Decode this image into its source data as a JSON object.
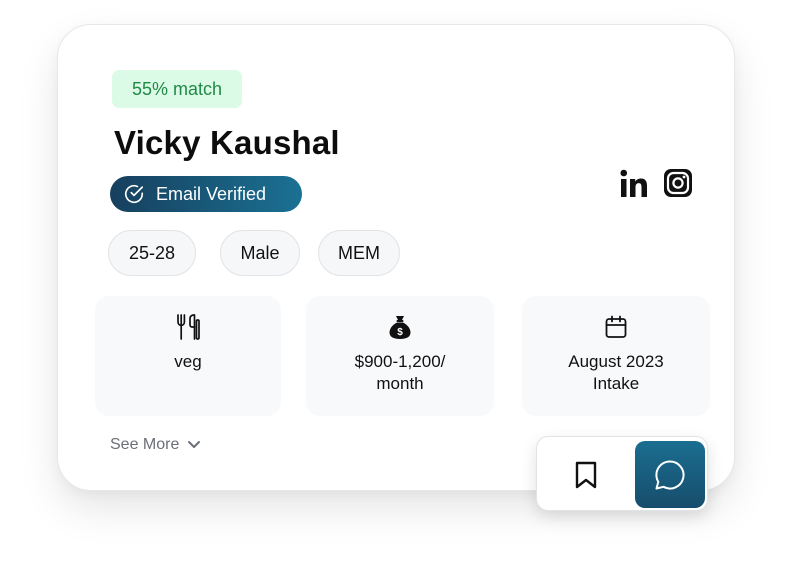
{
  "profile": {
    "match": "55% match",
    "name": "Vicky Kaushal",
    "verified": "Email Verified",
    "chips": [
      "25-28",
      "Male",
      "MEM"
    ],
    "tiles": [
      {
        "icon": "fork-knife-icon",
        "line1": "veg",
        "line2": ""
      },
      {
        "icon": "money-bag-icon",
        "line1": "$900-1,200/",
        "line2": "month"
      },
      {
        "icon": "calendar-icon",
        "line1": "August 2023",
        "line2": "Intake"
      }
    ],
    "see_more": "See More",
    "social": [
      "linkedin-icon",
      "instagram-icon"
    ]
  },
  "colors": {
    "match_bg": "#dcfbe7",
    "match_text": "#1f8a45",
    "accent_dark": "#173f5e",
    "accent_light": "#1a7193"
  }
}
